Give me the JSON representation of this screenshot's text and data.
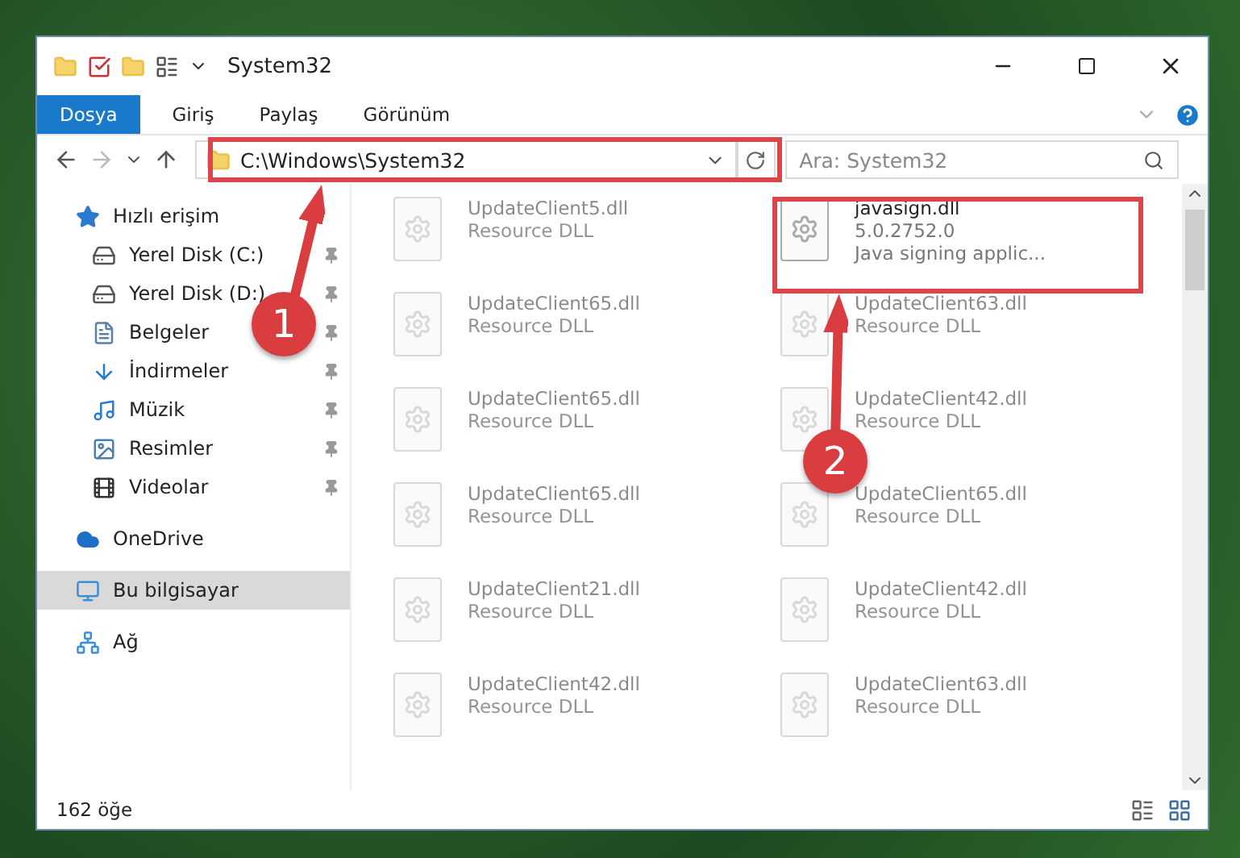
{
  "window": {
    "title": "System32"
  },
  "ribbon_tabs": [
    {
      "label": "Dosya",
      "kind": "file"
    },
    {
      "label": "Giriş",
      "kind": "tab"
    },
    {
      "label": "Paylaş",
      "kind": "tab"
    },
    {
      "label": "Görünüm",
      "kind": "tab"
    }
  ],
  "address": {
    "value": "C:\\Windows\\System32"
  },
  "search": {
    "placeholder": "Ara: System32"
  },
  "sidebar": {
    "items": [
      {
        "label": "Hızlı erişim",
        "selected": false,
        "children": [
          {
            "label": "Yerel Disk (C:)",
            "pinned": true
          },
          {
            "label": "Yerel Disk (D:)",
            "pinned": true
          },
          {
            "label": "Belgeler",
            "pinned": true
          },
          {
            "label": "İndirmeler",
            "pinned": true
          },
          {
            "label": "Müzik",
            "pinned": true
          },
          {
            "label": "Resimler",
            "pinned": true
          },
          {
            "label": "Videolar",
            "pinned": true
          }
        ]
      },
      {
        "label": "OneDrive",
        "selected": false
      },
      {
        "label": "Bu bilgisayar",
        "selected": true
      },
      {
        "label": "Ağ",
        "selected": false
      }
    ]
  },
  "files": [
    {
      "name": "UpdateClient5.dll",
      "details": [
        "Resource DLL"
      ],
      "faded": true
    },
    {
      "name": "javasign.dll",
      "details": [
        "5.0.2752.0",
        "Java signing applic..."
      ],
      "faded": false
    },
    {
      "name": "UpdateClient65.dll",
      "details": [
        "Resource DLL"
      ],
      "faded": true
    },
    {
      "name": "UpdateClient63.dll",
      "details": [
        "Resource DLL"
      ],
      "faded": true
    },
    {
      "name": "UpdateClient65.dll",
      "details": [
        "Resource DLL"
      ],
      "faded": true
    },
    {
      "name": "UpdateClient42.dll",
      "details": [
        "Resource DLL"
      ],
      "faded": true
    },
    {
      "name": "UpdateClient65.dll",
      "details": [
        "Resource DLL"
      ],
      "faded": true
    },
    {
      "name": "UpdateClient65.dll",
      "details": [
        "Resource DLL"
      ],
      "faded": true
    },
    {
      "name": "UpdateClient21.dll",
      "details": [
        "Resource DLL"
      ],
      "faded": true
    },
    {
      "name": "UpdateClient42.dll",
      "details": [
        "Resource DLL"
      ],
      "faded": true
    },
    {
      "name": "UpdateClient42.dll",
      "details": [
        "Resource DLL"
      ],
      "faded": true
    },
    {
      "name": "UpdateClient63.dll",
      "details": [
        "Resource DLL"
      ],
      "faded": true
    }
  ],
  "status_bar": {
    "count": "162 öğe"
  },
  "annotations": [
    {
      "number": "1"
    },
    {
      "number": "2"
    }
  ]
}
